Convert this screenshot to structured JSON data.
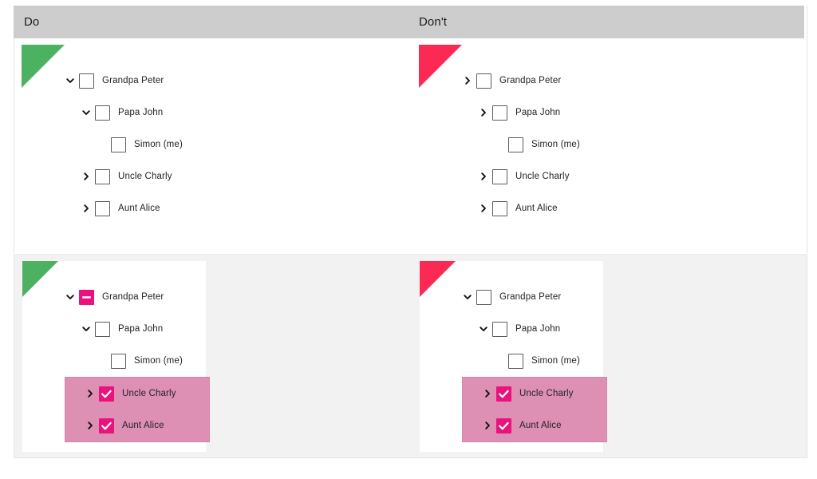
{
  "colors": {
    "header_bg": "#cdcdcd",
    "do_marker": "#4cb262",
    "dont_marker": "#fa2a55",
    "accent_magenta": "#e8137e",
    "selection_pink": "#dd90b4",
    "panel_gray": "#f2f2f2",
    "text": "#1f1f26"
  },
  "header": {
    "do_label": "Do",
    "dont_label": "Don't"
  },
  "panels": {
    "top_do": {
      "marker": "do-triangle",
      "rows": [
        {
          "label": "Grandpa Peter",
          "indent": 1,
          "chevron": "chevron-down",
          "checkbox": "unchecked",
          "selected": false
        },
        {
          "label": "Papa John",
          "indent": 2,
          "chevron": "chevron-down",
          "checkbox": "unchecked",
          "selected": false
        },
        {
          "label": "Simon (me)",
          "indent": 3,
          "chevron": "none",
          "checkbox": "unchecked",
          "selected": false
        },
        {
          "label": "Uncle Charly",
          "indent": 2,
          "chevron": "chevron-right",
          "checkbox": "unchecked",
          "selected": false
        },
        {
          "label": "Aunt Alice",
          "indent": 2,
          "chevron": "chevron-right",
          "checkbox": "unchecked",
          "selected": false
        }
      ]
    },
    "top_dont": {
      "marker": "dont-triangle",
      "rows": [
        {
          "label": "Grandpa Peter",
          "indent": 1,
          "chevron": "chevron-right",
          "checkbox": "unchecked",
          "selected": false
        },
        {
          "label": "Papa John",
          "indent": 2,
          "chevron": "chevron-right",
          "checkbox": "unchecked",
          "selected": false
        },
        {
          "label": "Simon (me)",
          "indent": 3,
          "chevron": "none",
          "checkbox": "unchecked",
          "selected": false
        },
        {
          "label": "Uncle Charly",
          "indent": 2,
          "chevron": "chevron-right",
          "checkbox": "unchecked",
          "selected": false
        },
        {
          "label": "Aunt Alice",
          "indent": 2,
          "chevron": "chevron-right",
          "checkbox": "unchecked",
          "selected": false
        }
      ]
    },
    "bottom_do": {
      "marker": "do-triangle",
      "rows": [
        {
          "label": "Grandpa Peter",
          "indent": 1,
          "chevron": "chevron-down",
          "checkbox": "indeterminate",
          "selected": false
        },
        {
          "label": "Papa John",
          "indent": 2,
          "chevron": "chevron-down",
          "checkbox": "unchecked",
          "selected": false
        },
        {
          "label": "Simon (me)",
          "indent": 3,
          "chevron": "none",
          "checkbox": "unchecked",
          "selected": false
        },
        {
          "label": "Uncle Charly",
          "indent": 2,
          "chevron": "chevron-right",
          "checkbox": "checked",
          "selected": true
        },
        {
          "label": "Aunt Alice",
          "indent": 2,
          "chevron": "chevron-right",
          "checkbox": "checked",
          "selected": true
        }
      ]
    },
    "bottom_dont": {
      "marker": "dont-triangle",
      "rows": [
        {
          "label": "Grandpa Peter",
          "indent": 1,
          "chevron": "chevron-down",
          "checkbox": "unchecked",
          "selected": false
        },
        {
          "label": "Papa John",
          "indent": 2,
          "chevron": "chevron-down",
          "checkbox": "unchecked",
          "selected": false
        },
        {
          "label": "Simon (me)",
          "indent": 3,
          "chevron": "none",
          "checkbox": "unchecked",
          "selected": false
        },
        {
          "label": "Uncle Charly",
          "indent": 2,
          "chevron": "chevron-right",
          "checkbox": "checked",
          "selected": true
        },
        {
          "label": "Aunt Alice",
          "indent": 2,
          "chevron": "chevron-right",
          "checkbox": "checked",
          "selected": true
        }
      ]
    }
  }
}
